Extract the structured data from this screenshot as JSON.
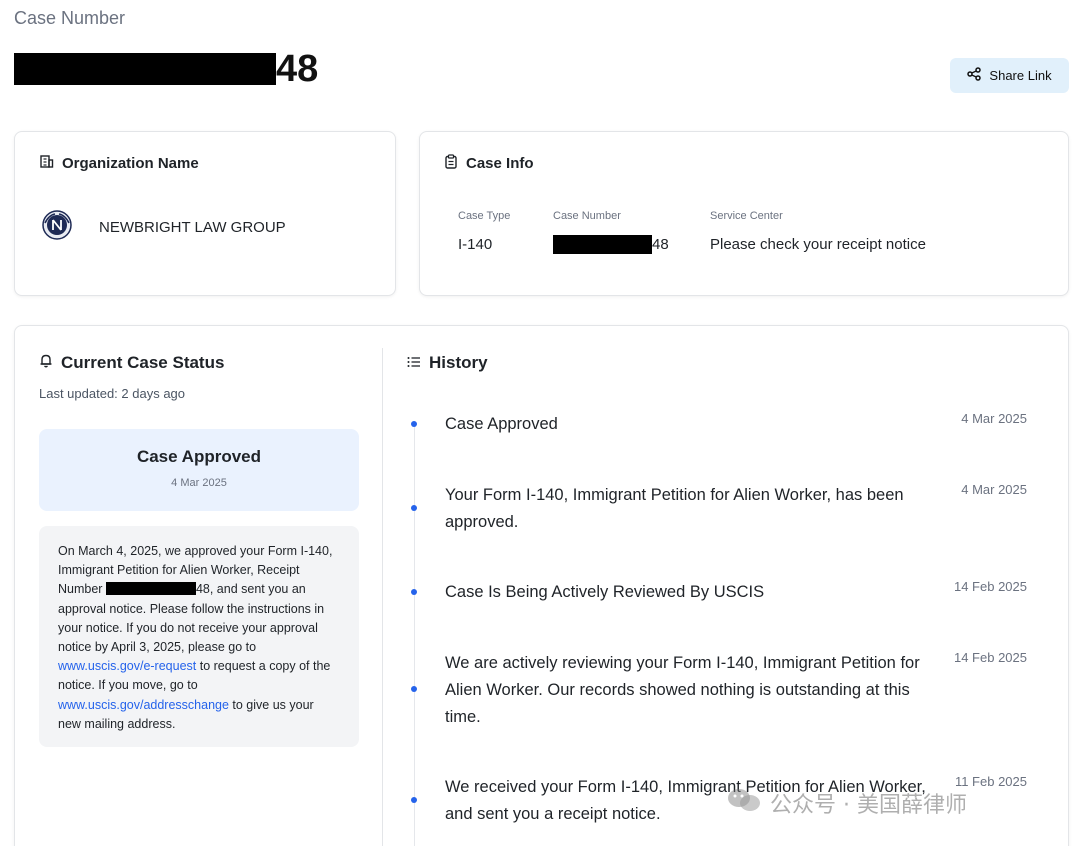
{
  "header": {
    "label": "Case Number",
    "case_number_suffix": "48",
    "share_label": "Share Link"
  },
  "organization": {
    "title": "Organization Name",
    "name": "NEWBRIGHT LAW GROUP"
  },
  "case_info": {
    "title": "Case Info",
    "case_type_label": "Case Type",
    "case_type": "I-140",
    "case_number_label": "Case Number",
    "case_number_suffix": "48",
    "service_center_label": "Service Center",
    "service_center": "Please check your receipt notice"
  },
  "status": {
    "title": "Current Case Status",
    "updated": "Last updated: 2 days ago",
    "current": "Case Approved",
    "date": "4 Mar 2025",
    "desc_part1": "On March 4, 2025, we approved your Form I-140, Immigrant Petition for Alien Worker, Receipt Number ",
    "desc_part2": "48, and sent you an approval notice. Please follow the instructions in your notice. If you do not receive your approval notice by April 3, 2025, please go to ",
    "link1": "www.uscis.gov/e-request",
    "desc_part3": " to request a copy of the notice. If you move, go to ",
    "link2": "www.uscis.gov/addresschange",
    "desc_part4": " to give us your new mailing address."
  },
  "history": {
    "title": "History",
    "items": [
      {
        "text": "Case Approved",
        "date": "4 Mar 2025"
      },
      {
        "text": "Your Form I-140, Immigrant Petition for Alien Worker, has been approved.",
        "date": "4 Mar 2025"
      },
      {
        "text": "Case Is Being Actively Reviewed By USCIS",
        "date": "14 Feb 2025"
      },
      {
        "text": "We are actively reviewing your Form I-140, Immigrant Petition for Alien Worker. Our records showed nothing is outstanding at this time.",
        "date": "14 Feb 2025"
      },
      {
        "text": "We received your Form I-140, Immigrant Petition for Alien Worker, and sent you a receipt notice.",
        "date": "11 Feb 2025"
      }
    ]
  },
  "watermark": {
    "text": "公众号 · 美国薛律师"
  },
  "colors": {
    "accent": "#2563eb",
    "approved_bg": "#eaf2fe",
    "share_bg": "#e1f0fb"
  }
}
